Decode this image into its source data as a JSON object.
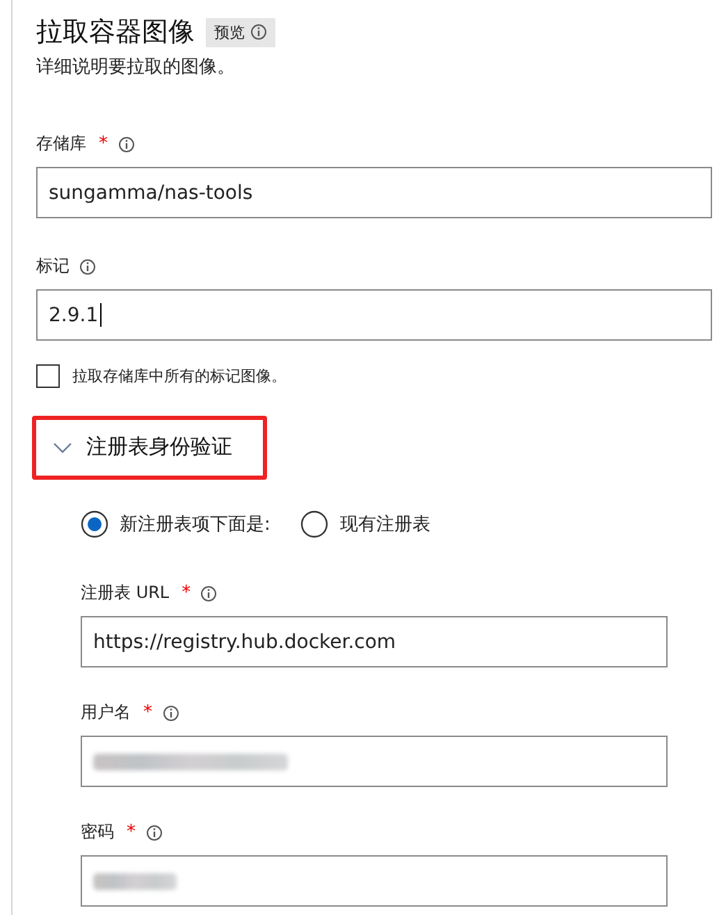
{
  "header": {
    "title": "拉取容器图像",
    "badge": "预览",
    "description": "详细说明要拉取的图像。"
  },
  "fields": [
    {
      "label": "存储库",
      "required_mark": "*",
      "value": "sungamma/nas-tools"
    },
    {
      "label": "标记",
      "value": "2.9.1",
      "focused": true
    }
  ],
  "checkbox": {
    "label": "拉取存储库中所有的标记图像。",
    "checked": false
  },
  "section": {
    "title": "注册表身份验证",
    "expanded": true,
    "highlighted": true,
    "radios": [
      {
        "label": "新注册表项下面是:",
        "selected": true
      },
      {
        "label": "现有注册表",
        "selected": false
      }
    ],
    "fields": [
      {
        "label": "注册表 URL",
        "required_mark": "*",
        "value": "https://registry.hub.docker.com"
      },
      {
        "label": "用户名",
        "required_mark": "*",
        "value_redacted": true
      },
      {
        "label": "密码",
        "required_mark": "*",
        "value_redacted": true
      }
    ]
  }
}
